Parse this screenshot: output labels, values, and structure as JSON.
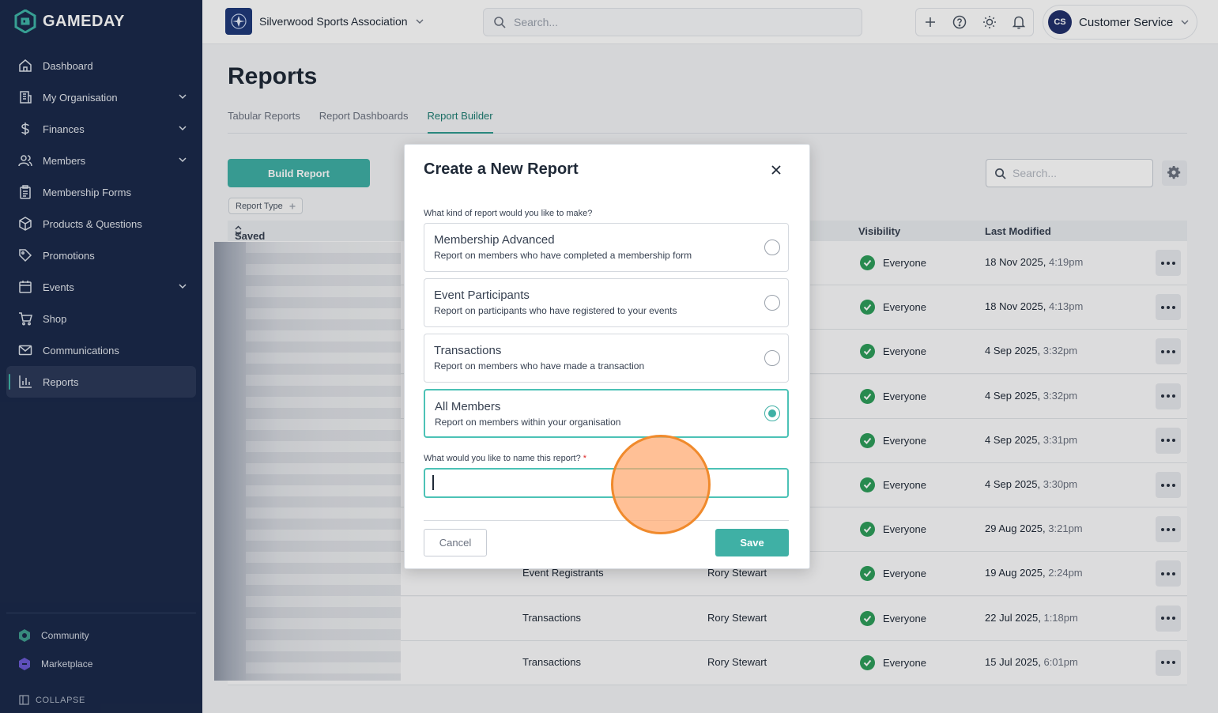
{
  "app": {
    "brand": "GAMEDAY"
  },
  "sidebar": {
    "items": [
      {
        "label": "Dashboard",
        "icon": "home-icon",
        "expandable": false
      },
      {
        "label": "My Organisation",
        "icon": "building-icon",
        "expandable": true
      },
      {
        "label": "Finances",
        "icon": "dollar-icon",
        "expandable": true
      },
      {
        "label": "Members",
        "icon": "users-icon",
        "expandable": true
      },
      {
        "label": "Membership Forms",
        "icon": "clipboard-icon",
        "expandable": false
      },
      {
        "label": "Products & Questions",
        "icon": "box-icon",
        "expandable": false
      },
      {
        "label": "Promotions",
        "icon": "tag-icon",
        "expandable": false
      },
      {
        "label": "Events",
        "icon": "calendar-icon",
        "expandable": true
      },
      {
        "label": "Shop",
        "icon": "cart-icon",
        "expandable": false
      },
      {
        "label": "Communications",
        "icon": "mail-icon",
        "expandable": false
      },
      {
        "label": "Reports",
        "icon": "bar-chart-icon",
        "expandable": false,
        "active": true
      }
    ],
    "bottom": {
      "community": "Community",
      "marketplace": "Marketplace",
      "collapse": "COLLAPSE"
    }
  },
  "topbar": {
    "org_name": "Silverwood Sports Association",
    "search_placeholder": "Search...",
    "user_initials": "CS",
    "user_name": "Customer Service"
  },
  "main": {
    "title": "Reports",
    "tabs": [
      {
        "label": "Tabular Reports",
        "active": false
      },
      {
        "label": "Report Dashboards",
        "active": false
      },
      {
        "label": "Report Builder",
        "active": true
      }
    ],
    "build_button": "Build Report",
    "filter_chip": "Report Type",
    "table_search_placeholder": "Search...",
    "columns": {
      "saved_name": "Saved Name",
      "visibility": "Visibility",
      "last_modified": "Last Modified"
    },
    "rows": [
      {
        "type": "",
        "owner": "",
        "visibility": "Everyone",
        "date": "18 Nov 2025,",
        "time": "4:19pm"
      },
      {
        "type": "",
        "owner": "",
        "visibility": "Everyone",
        "date": "18 Nov 2025,",
        "time": "4:13pm"
      },
      {
        "type": "",
        "owner": "",
        "visibility": "Everyone",
        "date": "4 Sep 2025,",
        "time": "3:32pm"
      },
      {
        "type": "",
        "owner": "",
        "visibility": "Everyone",
        "date": "4 Sep 2025,",
        "time": "3:32pm"
      },
      {
        "type": "",
        "owner": "",
        "visibility": "Everyone",
        "date": "4 Sep 2025,",
        "time": "3:31pm"
      },
      {
        "type": "",
        "owner": "",
        "visibility": "Everyone",
        "date": "4 Sep 2025,",
        "time": "3:30pm"
      },
      {
        "type": "",
        "owner": "",
        "visibility": "Everyone",
        "date": "29 Aug 2025,",
        "time": "3:21pm"
      },
      {
        "type": "Event Registrants",
        "owner": "Rory Stewart",
        "visibility": "Everyone",
        "date": "19 Aug 2025,",
        "time": "2:24pm"
      },
      {
        "type": "Transactions",
        "owner": "Rory Stewart",
        "visibility": "Everyone",
        "date": "22 Jul 2025,",
        "time": "1:18pm"
      },
      {
        "type": "Transactions",
        "owner": "Rory Stewart",
        "visibility": "Everyone",
        "date": "15 Jul 2025,",
        "time": "6:01pm"
      }
    ]
  },
  "modal": {
    "title": "Create a New Report",
    "question1": "What kind of report would you like to make?",
    "options": [
      {
        "title": "Membership Advanced",
        "desc": "Report on members who have completed a membership form",
        "selected": false
      },
      {
        "title": "Event Participants",
        "desc": "Report on participants who have registered to your events",
        "selected": false
      },
      {
        "title": "Transactions",
        "desc": "Report on members who have made a transaction",
        "selected": false
      },
      {
        "title": "All Members",
        "desc": "Report on members within your organisation",
        "selected": true
      }
    ],
    "question2": "What would you like to name this report?",
    "required_mark": "*",
    "name_value": "",
    "cancel": "Cancel",
    "save": "Save"
  },
  "colors": {
    "sidebar_bg": "#1b2a4a",
    "accent": "#3fb0a5",
    "success": "#2e9e5b",
    "click_marker": "#f08a2c"
  }
}
